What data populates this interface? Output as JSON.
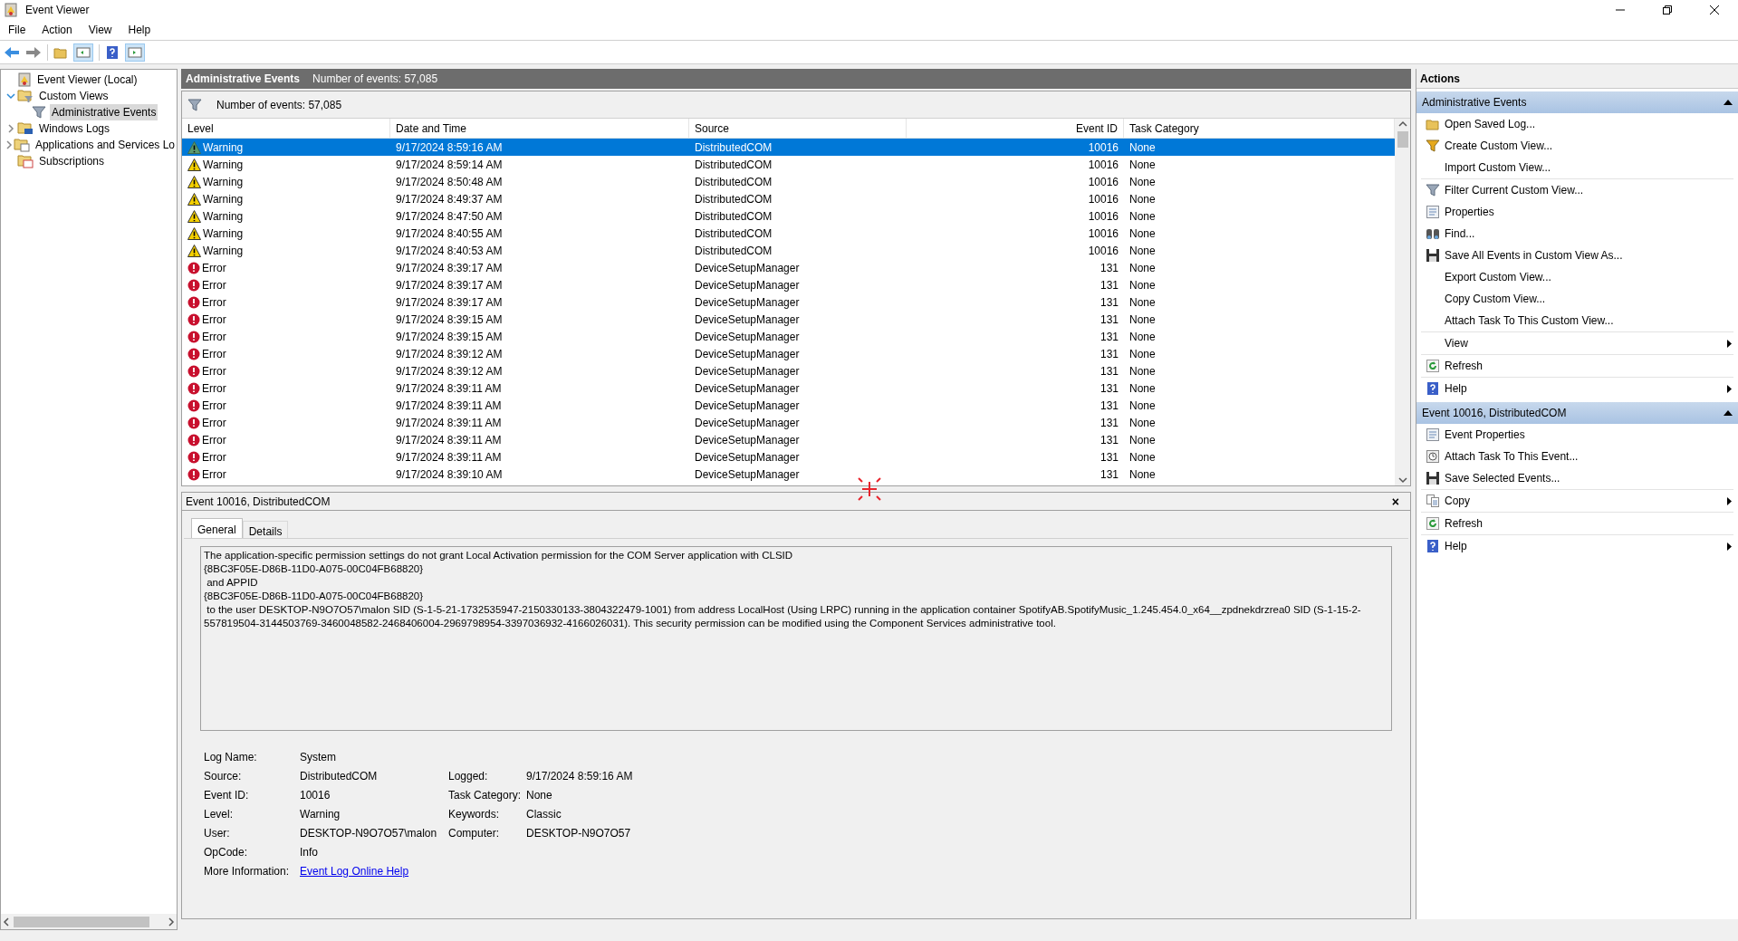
{
  "window": {
    "title": "Event Viewer"
  },
  "menu": [
    "File",
    "Action",
    "View",
    "Help"
  ],
  "tree": [
    {
      "label": "Event Viewer (Local)",
      "children": [
        {
          "label": "Custom Views",
          "expanded": true,
          "selected": false,
          "children": [
            {
              "label": "Administrative Events",
              "selected": true
            }
          ]
        },
        {
          "label": "Windows Logs",
          "expanded": false,
          "selected": false
        },
        {
          "label": "Applications and Services Lo",
          "expanded": false,
          "selected": false
        },
        {
          "label": "Subscriptions",
          "selected": false
        }
      ]
    }
  ],
  "view_header": {
    "title": "Administrative Events",
    "count": "Number of events: 57,085"
  },
  "filter_bar": {
    "text": "Number of events: 57,085"
  },
  "table": {
    "columns": [
      "Level",
      "Date and Time",
      "Source",
      "Event ID",
      "Task Category"
    ],
    "rows": [
      {
        "kind": "warning",
        "level": "Warning",
        "date": "9/17/2024 8:59:16 AM",
        "source": "DistributedCOM",
        "event_id": "10016",
        "category": "None",
        "selected": true
      },
      {
        "kind": "warning",
        "level": "Warning",
        "date": "9/17/2024 8:59:14 AM",
        "source": "DistributedCOM",
        "event_id": "10016",
        "category": "None",
        "selected": false
      },
      {
        "kind": "warning",
        "level": "Warning",
        "date": "9/17/2024 8:50:48 AM",
        "source": "DistributedCOM",
        "event_id": "10016",
        "category": "None",
        "selected": false
      },
      {
        "kind": "warning",
        "level": "Warning",
        "date": "9/17/2024 8:49:37 AM",
        "source": "DistributedCOM",
        "event_id": "10016",
        "category": "None",
        "selected": false
      },
      {
        "kind": "warning",
        "level": "Warning",
        "date": "9/17/2024 8:47:50 AM",
        "source": "DistributedCOM",
        "event_id": "10016",
        "category": "None",
        "selected": false
      },
      {
        "kind": "warning",
        "level": "Warning",
        "date": "9/17/2024 8:40:55 AM",
        "source": "DistributedCOM",
        "event_id": "10016",
        "category": "None",
        "selected": false
      },
      {
        "kind": "warning",
        "level": "Warning",
        "date": "9/17/2024 8:40:53 AM",
        "source": "DistributedCOM",
        "event_id": "10016",
        "category": "None",
        "selected": false
      },
      {
        "kind": "error",
        "level": "Error",
        "date": "9/17/2024 8:39:17 AM",
        "source": "DeviceSetupManager",
        "event_id": "131",
        "category": "None",
        "selected": false
      },
      {
        "kind": "error",
        "level": "Error",
        "date": "9/17/2024 8:39:17 AM",
        "source": "DeviceSetupManager",
        "event_id": "131",
        "category": "None",
        "selected": false
      },
      {
        "kind": "error",
        "level": "Error",
        "date": "9/17/2024 8:39:17 AM",
        "source": "DeviceSetupManager",
        "event_id": "131",
        "category": "None",
        "selected": false
      },
      {
        "kind": "error",
        "level": "Error",
        "date": "9/17/2024 8:39:15 AM",
        "source": "DeviceSetupManager",
        "event_id": "131",
        "category": "None",
        "selected": false
      },
      {
        "kind": "error",
        "level": "Error",
        "date": "9/17/2024 8:39:15 AM",
        "source": "DeviceSetupManager",
        "event_id": "131",
        "category": "None",
        "selected": false
      },
      {
        "kind": "error",
        "level": "Error",
        "date": "9/17/2024 8:39:12 AM",
        "source": "DeviceSetupManager",
        "event_id": "131",
        "category": "None",
        "selected": false
      },
      {
        "kind": "error",
        "level": "Error",
        "date": "9/17/2024 8:39:12 AM",
        "source": "DeviceSetupManager",
        "event_id": "131",
        "category": "None",
        "selected": false
      },
      {
        "kind": "error",
        "level": "Error",
        "date": "9/17/2024 8:39:11 AM",
        "source": "DeviceSetupManager",
        "event_id": "131",
        "category": "None",
        "selected": false
      },
      {
        "kind": "error",
        "level": "Error",
        "date": "9/17/2024 8:39:11 AM",
        "source": "DeviceSetupManager",
        "event_id": "131",
        "category": "None",
        "selected": false
      },
      {
        "kind": "error",
        "level": "Error",
        "date": "9/17/2024 8:39:11 AM",
        "source": "DeviceSetupManager",
        "event_id": "131",
        "category": "None",
        "selected": false
      },
      {
        "kind": "error",
        "level": "Error",
        "date": "9/17/2024 8:39:11 AM",
        "source": "DeviceSetupManager",
        "event_id": "131",
        "category": "None",
        "selected": false
      },
      {
        "kind": "error",
        "level": "Error",
        "date": "9/17/2024 8:39:11 AM",
        "source": "DeviceSetupManager",
        "event_id": "131",
        "category": "None",
        "selected": false
      },
      {
        "kind": "error",
        "level": "Error",
        "date": "9/17/2024 8:39:10 AM",
        "source": "DeviceSetupManager",
        "event_id": "131",
        "category": "None",
        "selected": false
      }
    ]
  },
  "details": {
    "title": "Event 10016, DistributedCOM",
    "close": "×",
    "tabs": [
      {
        "label": "General",
        "selected": true
      },
      {
        "label": "Details",
        "selected": false
      }
    ],
    "description": "The application-specific permission settings do not grant Local Activation permission for the COM Server application with CLSID\n{8BC3F05E-D86B-11D0-A075-00C04FB68820}\n and APPID\n{8BC3F05E-D86B-11D0-A075-00C04FB68820}\n to the user DESKTOP-N9O7O57\\malon SID (S-1-5-21-1732535947-2150330133-3804322479-1001) from address LocalHost (Using LRPC) running in the application container SpotifyAB.SpotifyMusic_1.245.454.0_x64__zpdnekdrzrea0 SID (S-1-15-2-557819504-3144503769-3460048582-2468406004-2969798954-3397036932-4166026031). This security permission can be modified using the Component Services administrative tool.",
    "fields": [
      {
        "label": "Log Name:",
        "value": "System"
      },
      {
        "label": "Source:",
        "value": "DistributedCOM",
        "label2": "Logged:",
        "value2": "9/17/2024 8:59:16 AM"
      },
      {
        "label": "Event ID:",
        "value": "10016",
        "label2": "Task Category:",
        "value2": "None"
      },
      {
        "label": "Level:",
        "value": "Warning",
        "label2": "Keywords:",
        "value2": "Classic"
      },
      {
        "label": "User:",
        "value": "DESKTOP-N9O7O57\\malon",
        "label2": "Computer:",
        "value2": "DESKTOP-N9O7O57"
      },
      {
        "label": "OpCode:",
        "value": "Info"
      },
      {
        "label": "More Information:",
        "link": "Event Log Online Help"
      }
    ]
  },
  "actions": {
    "title": "Actions",
    "sections": [
      {
        "title": "Administrative Events",
        "expanded": true,
        "groups": [
          [
            {
              "label": "Open Saved Log...",
              "submenu": false
            },
            {
              "label": "Create Custom View...",
              "submenu": false
            },
            {
              "label": "Import Custom View...",
              "submenu": false
            }
          ],
          [
            {
              "label": "Filter Current Custom View...",
              "submenu": false
            },
            {
              "label": "Properties",
              "submenu": false
            },
            {
              "label": "Find...",
              "submenu": false
            },
            {
              "label": "Save All Events in Custom View As...",
              "submenu": false
            },
            {
              "label": "Export Custom View...",
              "submenu": false
            },
            {
              "label": "Copy Custom View...",
              "submenu": false
            },
            {
              "label": "Attach Task To This Custom View...",
              "submenu": false
            }
          ],
          [
            {
              "label": "View",
              "submenu": true
            }
          ],
          [
            {
              "label": "Refresh",
              "submenu": false
            }
          ],
          [
            {
              "label": "Help",
              "submenu": true
            }
          ]
        ]
      },
      {
        "title": "Event 10016, DistributedCOM",
        "expanded": true,
        "groups": [
          [
            {
              "label": "Event Properties",
              "submenu": false
            },
            {
              "label": "Attach Task To This Event...",
              "submenu": false
            },
            {
              "label": "Save Selected Events...",
              "submenu": false
            }
          ],
          [
            {
              "label": "Copy",
              "submenu": true
            }
          ],
          [
            {
              "label": "Refresh",
              "submenu": false
            }
          ],
          [
            {
              "label": "Help",
              "submenu": true
            }
          ]
        ]
      }
    ]
  }
}
